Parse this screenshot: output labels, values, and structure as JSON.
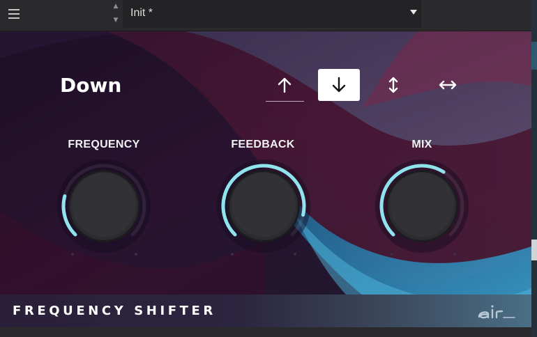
{
  "header": {
    "preset_name": "Init *",
    "menu_icon": "hamburger-menu-icon",
    "prev_icon": "triangle-up-icon",
    "next_icon": "triangle-down-icon",
    "dropdown_icon": "caret-down-icon"
  },
  "mode": {
    "label": "Down",
    "buttons": [
      {
        "name": "up",
        "icon": "arrow-up-icon",
        "selected": false
      },
      {
        "name": "down",
        "icon": "arrow-down-icon",
        "selected": true
      },
      {
        "name": "up-down",
        "icon": "arrow-up-down-icon",
        "selected": false
      },
      {
        "name": "left-right",
        "icon": "arrow-left-right-icon",
        "selected": false
      }
    ]
  },
  "knobs": [
    {
      "label": "FREQUENCY",
      "value": 0.22
    },
    {
      "label": "FEEDBACK",
      "value": 0.88
    },
    {
      "label": "MIX",
      "value": 0.62
    }
  ],
  "footer": {
    "title": "FREQUENCY SHIFTER",
    "logo_text": "air"
  },
  "colors": {
    "accent": "#8fe3ec",
    "selected_button": "#ffffff",
    "knob_body": "#2c2c30"
  }
}
